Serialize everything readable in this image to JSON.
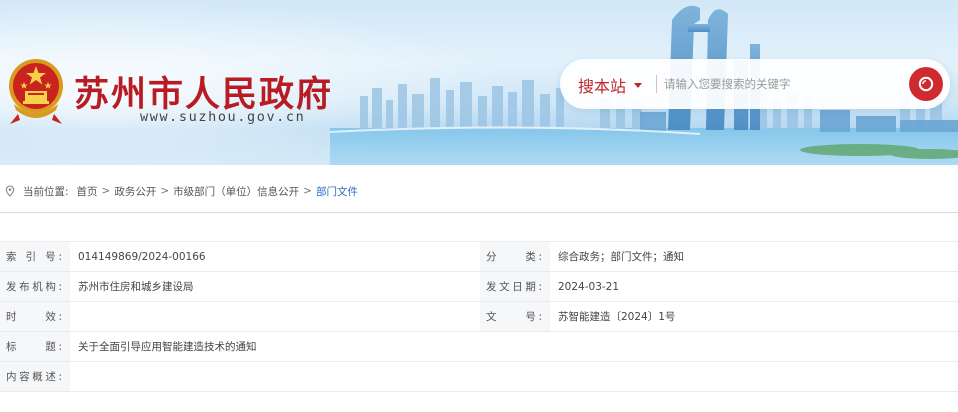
{
  "header": {
    "site_title": "苏州市人民政府",
    "site_url": "www.suzhou.gov.cn",
    "search": {
      "scope_label": "搜本站",
      "placeholder": "请输入您要搜索的关键字",
      "button_icon": "search-icon"
    },
    "colors": {
      "brand_red": "#b81c22",
      "accent_red": "#cf2a2e",
      "link_blue": "#2c6bc4"
    }
  },
  "breadcrumb": {
    "prefix": "当前位置:",
    "items": [
      "首页",
      "政务公开",
      "市级部门（单位）信息公开",
      "部门文件"
    ],
    "separator": ">"
  },
  "info": {
    "rows": [
      [
        {
          "label": "索 引 号:",
          "value": "014149869/2024-00166"
        },
        {
          "label": "分　　类:",
          "value": "综合政务；部门文件；通知"
        }
      ],
      [
        {
          "label": "发布机构:",
          "value": "苏州市住房和城乡建设局"
        },
        {
          "label": "发文日期:",
          "value": "2024-03-21"
        }
      ],
      [
        {
          "label": "时　　效:",
          "value": ""
        },
        {
          "label": "文　　号:",
          "value": "苏智能建造〔2024〕1号"
        }
      ],
      [
        {
          "label": "标　　题:",
          "value": "关于全面引导应用智能建造技术的通知"
        }
      ],
      [
        {
          "label": "内容概述:",
          "value": ""
        }
      ]
    ]
  }
}
